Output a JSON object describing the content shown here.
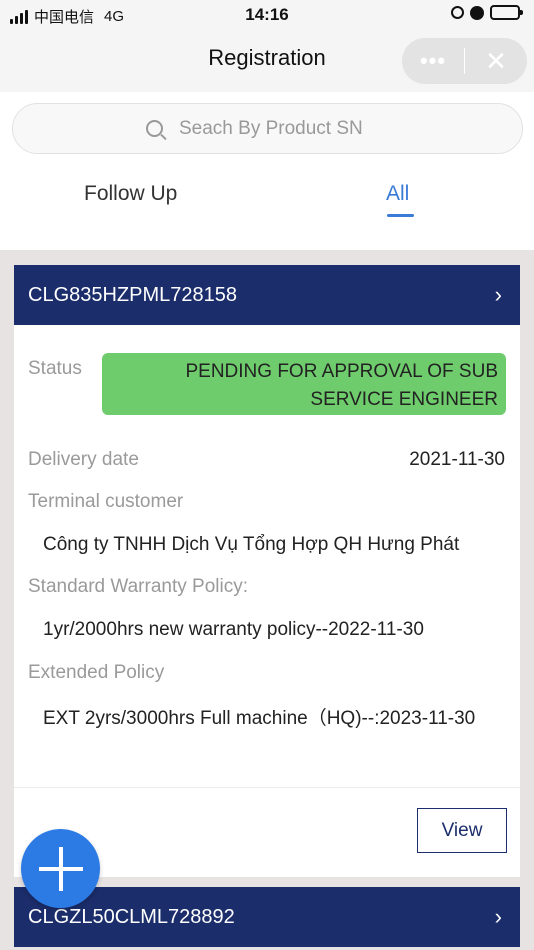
{
  "status_bar": {
    "carrier": "中国电信",
    "network": "4G",
    "time": "14:16"
  },
  "navbar": {
    "title": "Registration",
    "more_label": "•••",
    "close_label": "✕"
  },
  "search": {
    "placeholder": "Seach By Product SN"
  },
  "tabs": [
    {
      "label": "Follow Up",
      "active": false
    },
    {
      "label": "All",
      "active": true
    }
  ],
  "cards": [
    {
      "sn": "CLG835HZPML728158",
      "status_label": "Status",
      "status_value": "PENDING FOR APPROVAL OF SUB SERVICE ENGINEER",
      "delivery_label": "Delivery date",
      "delivery_value": "2021-11-30",
      "terminal_label": "Terminal customer",
      "terminal_value": "Công ty TNHH Dịch Vụ Tổng Hợp QH Hưng Phát",
      "warranty_label": "Standard Warranty Policy:",
      "warranty_value": "1yr/2000hrs new warranty policy--2022-11-30",
      "extended_label": "Extended Policy",
      "extended_value": "EXT 2yrs/3000hrs Full machine（HQ)--:2023-11-30",
      "view_label": "View"
    },
    {
      "sn": "CLGZL50CLML728892"
    }
  ],
  "colors": {
    "accent": "#3a7bd5",
    "header_navy": "#1b2d6b",
    "status_green": "#6ecc6c",
    "fab_blue": "#2c7be5"
  },
  "icons": {
    "search": "search-icon",
    "chevron": "chevron-right-icon",
    "fab": "plus-icon"
  }
}
